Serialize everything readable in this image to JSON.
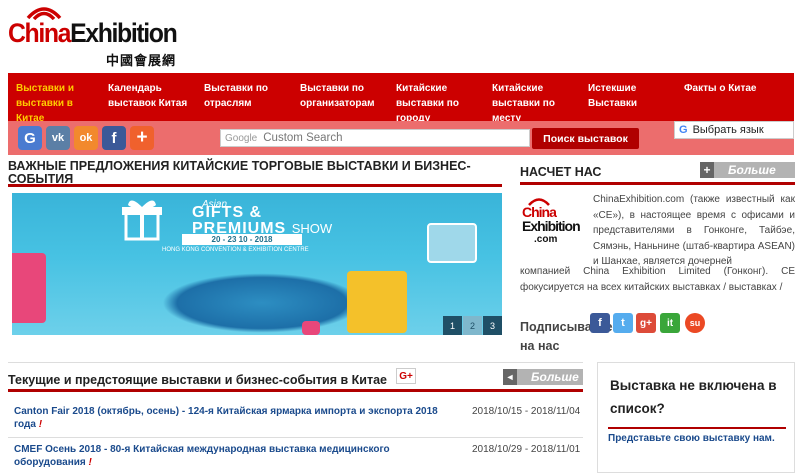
{
  "logo": {
    "word_red": "China",
    "word_black": "Exhibition",
    "chinese": "中國會展網"
  },
  "nav": [
    {
      "label": "Выставки и выставки в Китае"
    },
    {
      "label": "Календарь выставок Китая"
    },
    {
      "label": "Выставки по отраслям"
    },
    {
      "label": "Выставки по организаторам"
    },
    {
      "label": "Китайские выставки по городу"
    },
    {
      "label": "Китайские выставки по месту"
    },
    {
      "label": "Истекшие Выставки"
    },
    {
      "label": "Факты о Китае"
    }
  ],
  "social": [
    {
      "icon": "google-icon",
      "glyph": "G",
      "color": "#4a7bd0"
    },
    {
      "icon": "vk-icon",
      "glyph": "vk",
      "color": "#5b7fa6"
    },
    {
      "icon": "odnoklassniki-icon",
      "glyph": "ok",
      "color": "#f2892d"
    },
    {
      "icon": "facebook-icon",
      "glyph": "f",
      "color": "#3b5998"
    },
    {
      "icon": "share-plus-icon",
      "glyph": "+",
      "color": "#f0612d"
    }
  ],
  "search": {
    "google_label": "Google",
    "placeholder": "Custom Search",
    "button": "Поиск выставок"
  },
  "translate": {
    "label": "Выбрать язык",
    "glyph": "G"
  },
  "featured": {
    "title": "ВАЖНЫЕ ПРЕДЛОЖЕНИЯ КИТАЙСКИЕ ТОРГОВЫЕ ВЫСТАВКИ И БИЗНЕС-СОБЫТИЯ",
    "banner": {
      "asian": "Asian",
      "title": "GIFTS &",
      "title2": "PREMIUMS",
      "show": "SHOW",
      "dates": "20 - 23 10 - 2018",
      "venue": "HONG KONG CONVENTION & EXHIBITION CENTRE"
    },
    "slides": [
      "1",
      "2",
      "3"
    ],
    "active_slide": "2"
  },
  "about": {
    "title": "НАСЧЕТ НАС",
    "more": "Больше",
    "more_sign": "+",
    "logo_top": "China",
    "logo_mid": "Exhibition",
    "logo_bottom": ".com",
    "text_right": "ChinaExhibition.com (также известный как «CE»), в настоящее время с офисами и представителями в Гонконге, Тайбэе, Сямэнь, Наньнине (штаб-квартира ASEAN) и Шанхае, является дочерней",
    "text_full": "компанией China Exhibition Limited (Гонконг). CE фокусируется на всех китайских выставках / выставках /",
    "subscribe": "Подписывайтесь на нас"
  },
  "subscribe_icons": [
    {
      "icon": "facebook-icon",
      "glyph": "f",
      "color": "#3b5998"
    },
    {
      "icon": "twitter-icon",
      "glyph": "t",
      "color": "#55acee"
    },
    {
      "icon": "google-plus-icon",
      "glyph": "g+",
      "color": "#dd4b39"
    },
    {
      "icon": "delicious-icon",
      "glyph": "it",
      "color": "#3aa63a"
    },
    {
      "icon": "stumbleupon-icon",
      "glyph": "su",
      "color": "#eb4924"
    }
  ],
  "events": {
    "title": "Текущие и предстоящие выставки и бизнес-события в Китае",
    "gplus": "G+",
    "more": "Больше",
    "more_sign": "◄",
    "items": [
      {
        "name": "Canton Fair 2018 (октябрь, осень) - 124-я Китайская ярмарка импорта и экспорта 2018 года",
        "mark": "!",
        "date": "2018/10/15 - 2018/11/04"
      },
      {
        "name": "CMEF Осень 2018 - 80-я Китайская международная выставка медицинского оборудования",
        "mark": "!",
        "date": "2018/10/29 - 2018/11/01"
      }
    ]
  },
  "side": {
    "title": "Выставка не включена в список?",
    "link": "Представьте свою выставку нам."
  }
}
